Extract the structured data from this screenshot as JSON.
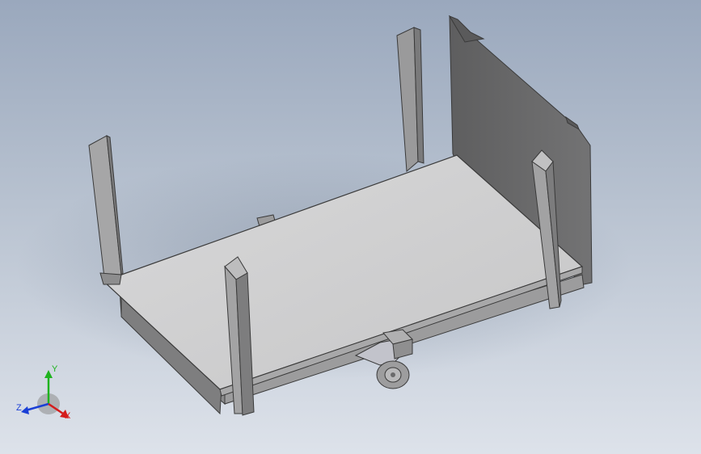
{
  "viewport": {
    "background_top": "#9aa8bd",
    "background_bottom": "#dde2ea"
  },
  "model": {
    "name": "flat-cart-with-end-panel",
    "colors": {
      "deck_top": "#cfcfd0",
      "frame": "#8e8e8e",
      "frame_dark": "#6f6f70",
      "post_light": "#a9a9ab",
      "post_dark": "#7f7f80",
      "end_panel": "#6d6d6e",
      "caster": "#bfc0c8"
    }
  },
  "triad": {
    "axes": [
      {
        "name": "y-axis",
        "label": "Y",
        "color": "#1fb31f"
      },
      {
        "name": "z-axis",
        "label": "Z",
        "color": "#1a3fd6"
      },
      {
        "name": "x-axis",
        "label": "X",
        "color": "#d41c1c"
      }
    ]
  }
}
